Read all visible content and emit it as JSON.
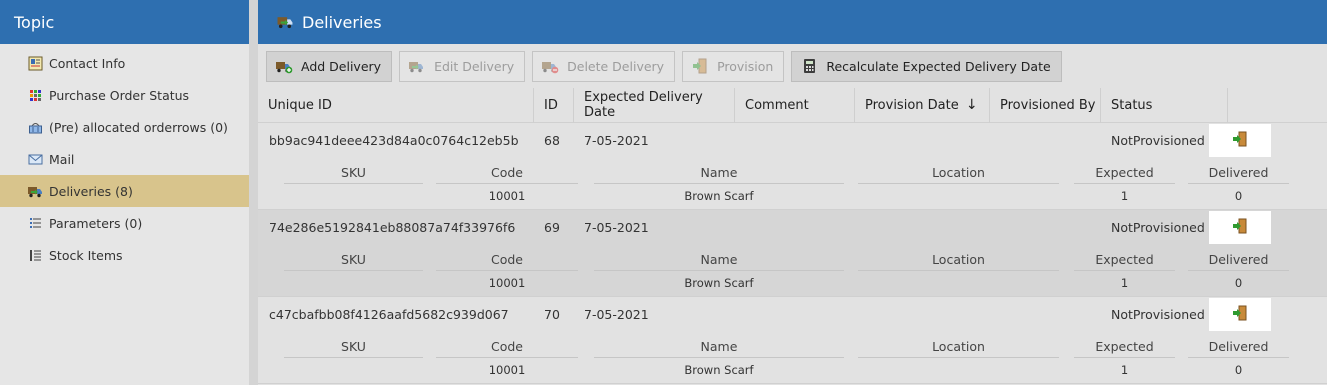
{
  "sidebar": {
    "title": "Topic",
    "items": [
      {
        "label": "Contact Info",
        "icon": "contact-card-icon"
      },
      {
        "label": "Purchase Order Status",
        "icon": "status-grid-icon"
      },
      {
        "label": "(Pre) allocated orderrows (0)",
        "icon": "basket-icon"
      },
      {
        "label": "Mail",
        "icon": "envelope-icon"
      },
      {
        "label": "Deliveries (8)",
        "icon": "truck-icon",
        "active": true
      },
      {
        "label": "Parameters (0)",
        "icon": "parameters-icon"
      },
      {
        "label": "Stock Items",
        "icon": "list-icon"
      }
    ]
  },
  "main": {
    "title": "Deliveries",
    "toolbar": {
      "add_delivery": "Add Delivery",
      "edit_delivery": "Edit Delivery",
      "delete_delivery": "Delete Delivery",
      "provision": "Provision",
      "recalculate": "Recalculate Expected Delivery Date"
    },
    "columns": {
      "unique_id": "Unique ID",
      "id": "ID",
      "expected_date": "Expected Delivery Date",
      "comment": "Comment",
      "provision_date": "Provision Date",
      "provisioned_by": "Provisioned By",
      "status": "Status",
      "sort_arrow": "↓"
    },
    "sub_columns": {
      "sku": "SKU",
      "code": "Code",
      "name": "Name",
      "location": "Location",
      "expected": "Expected",
      "delivered": "Delivered"
    },
    "rows": [
      {
        "unique_id": "bb9ac941deee423d84a0c0764c12eb5b",
        "id": "68",
        "expected_date": "7-05-2021",
        "status": "NotProvisioned",
        "item": {
          "sku": "",
          "code": "10001",
          "name": "Brown Scarf",
          "location": "",
          "expected": "1",
          "delivered": "0"
        }
      },
      {
        "unique_id": "74e286e5192841eb88087a74f33976f6",
        "id": "69",
        "expected_date": "7-05-2021",
        "status": "NotProvisioned",
        "item": {
          "sku": "",
          "code": "10001",
          "name": "Brown Scarf",
          "location": "",
          "expected": "1",
          "delivered": "0"
        }
      },
      {
        "unique_id": "c47cbafbb08f4126aafd5682c939d067",
        "id": "70",
        "expected_date": "7-05-2021",
        "status": "NotProvisioned",
        "item": {
          "sku": "",
          "code": "10001",
          "name": "Brown Scarf",
          "location": "",
          "expected": "1",
          "delivered": "0"
        }
      }
    ]
  },
  "colors": {
    "header_blue": "#2e6fb0",
    "active_item": "#d8c48c"
  }
}
